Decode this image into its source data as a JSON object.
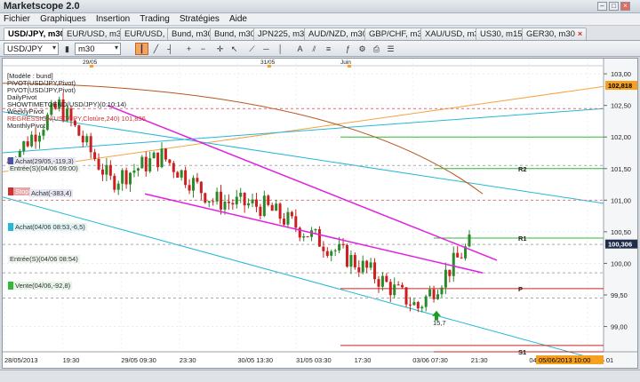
{
  "app": {
    "title": "Marketscope 2.0"
  },
  "menu": [
    "Fichier",
    "Graphiques",
    "Insertion",
    "Trading",
    "Stratégies",
    "Aide"
  ],
  "tabs": [
    {
      "label": "USD/JPY, m30",
      "active": true
    },
    {
      "label": "EUR/USD, m30",
      "active": false
    },
    {
      "label": "EUR/USD, H4",
      "active": false
    },
    {
      "label": "Bund, m30",
      "active": false
    },
    {
      "label": "Bund, m30",
      "active": false
    },
    {
      "label": "JPN225, m30",
      "active": false
    },
    {
      "label": "AUD/NZD, m30",
      "active": false
    },
    {
      "label": "GBP/CHF, m30",
      "active": false
    },
    {
      "label": "XAU/USD, m30",
      "active": false
    },
    {
      "label": "US30, m15",
      "active": false
    },
    {
      "label": "GER30, m30",
      "active": false
    }
  ],
  "toolbar": {
    "instrument": "USD/JPY",
    "timeframe": "m30"
  },
  "legend": [
    {
      "text": "[Modèle : bund]",
      "red": false
    },
    {
      "text": "PIVOT(USD/JPY,Pivot)",
      "red": false
    },
    {
      "text": "PIVOT(USD/JPY,Pivot)",
      "red": false
    },
    {
      "text": "DailyPivot",
      "red": false
    },
    {
      "text": "SHOWTIMETOEND(USD/JPY)(0:10:14)",
      "red": false
    },
    {
      "text": "WeeklyPivot",
      "red": false
    },
    {
      "text": "REGRESSION(USD/JPY,Clotûre,240) 101,836",
      "red": true
    },
    {
      "text": "MonthlyPivot",
      "red": false
    }
  ],
  "order_labels": {
    "achat1": "Achat(29/05,-119,3)",
    "entree1": "Entrée(S)(04/06 09:00)",
    "stop": "Stop",
    "achat2": "Achat(-383,4)",
    "achat3": "Achat(04/06 08:53,-6,5)",
    "entree2": "Entrée(S)(04/06 08:54)",
    "vente": "Vente(04/06,-92,8)"
  },
  "pivot_labels": {
    "r2": "R2",
    "r1": "R1",
    "p": "P",
    "s1": "S1"
  },
  "signal_value": "15,7",
  "price_badges": {
    "top": "102,818",
    "current": "100,306"
  },
  "time_badge": "05/06/2013 10:00",
  "chart_data": {
    "type": "candlestick",
    "instrument": "USD/JPY",
    "timeframe": "m30",
    "y_ticks": [
      "103,00",
      "102,50",
      "102,00",
      "101,50",
      "101,00",
      "100,50",
      "100,00",
      "99,50",
      "99,00"
    ],
    "y_range": [
      98.6,
      103.1
    ],
    "x_top_labels": [
      "29/05",
      "31/05",
      "Juin"
    ],
    "x_labels": [
      "28/05/2013",
      "19:30",
      "29/05 09:30",
      "23:30",
      "30/05 13:30",
      "31/05 03:30",
      "17:30",
      "03/06 07:30",
      "21:30",
      "04/06 11:30",
      "05/06 01"
    ],
    "pivots": {
      "R2": 101.5,
      "R1": 100.4,
      "P": 99.6,
      "S1": 98.7
    },
    "close_current": 100.306,
    "candle_count": 118,
    "key_closes": [
      101.6,
      102.5,
      101.3,
      101.7,
      101.0,
      100.9,
      100.4,
      99.9,
      99.3,
      100.3
    ]
  },
  "colors": {
    "bull": "#2a8a2a",
    "bear": "#cc1f1f",
    "channel": "#e020e0",
    "cyan": "#25b9d6",
    "orange": "#f5a342",
    "brown": "#b8541c",
    "pivot": "#cc2222",
    "green_level": "#32b832",
    "badge_orange": "#f5a01e"
  }
}
